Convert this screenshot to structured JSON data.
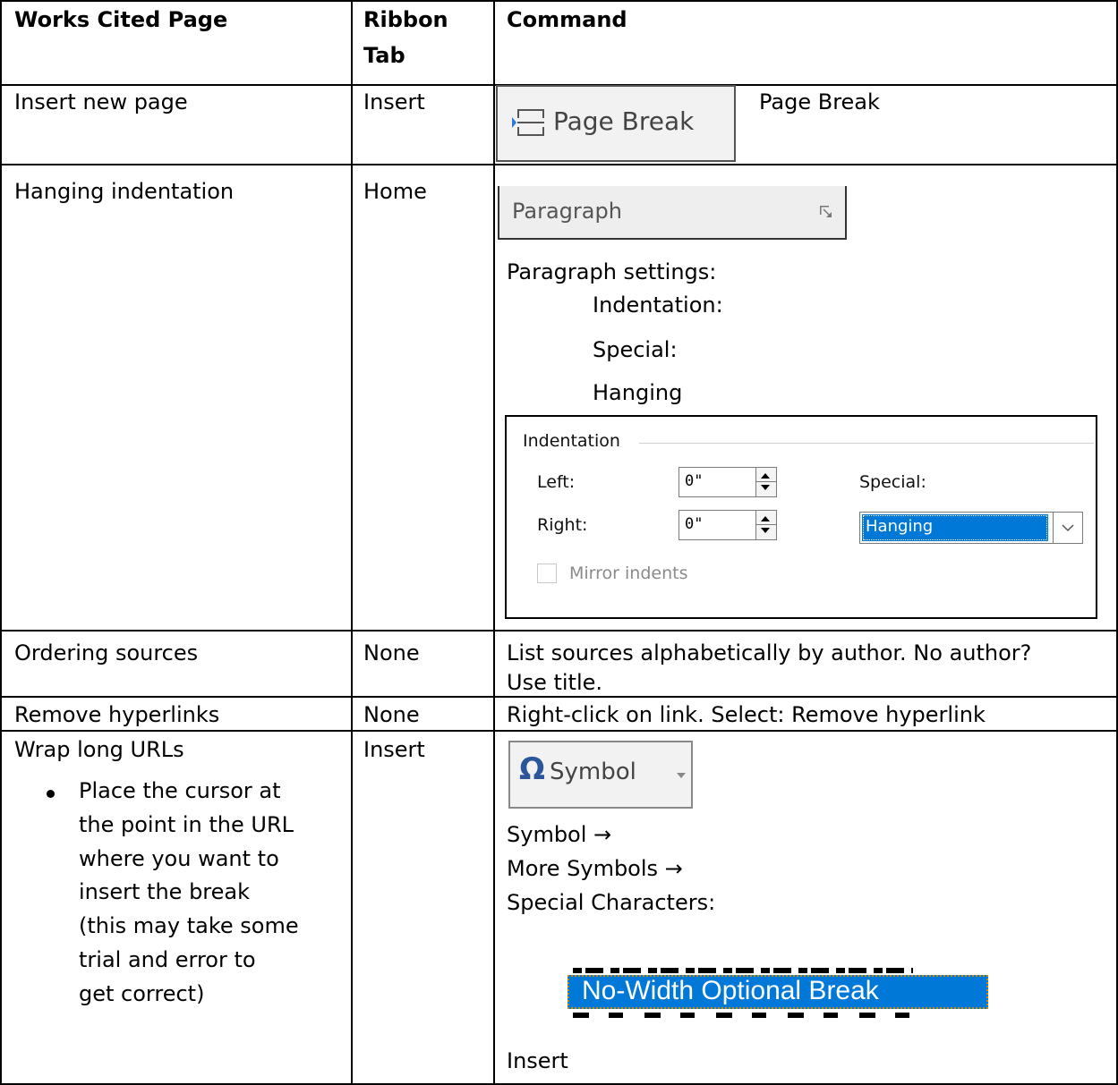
{
  "header": {
    "col1": "Works Cited Page",
    "col2_line1": "Ribbon",
    "col2_line2": "Tab",
    "col3": "Command"
  },
  "rows": {
    "insert_page": {
      "task": "Insert new page",
      "tab": "Insert",
      "button_label": "Page Break",
      "command": "Page Break"
    },
    "hanging": {
      "task": "Hanging indentation",
      "tab": "Home",
      "group_label": "Paragraph",
      "settings": "Paragraph settings:",
      "step1": "Indentation:",
      "step2": "Special:",
      "step3": "Hanging",
      "dialog": {
        "group_title": "Indentation",
        "left_label": "Left:",
        "left_value": "0\"",
        "right_label": "Right:",
        "right_value": "0\"",
        "special_label": "Special:",
        "special_value": "Hanging",
        "mirror_label": "Mirror indents"
      }
    },
    "ordering": {
      "task": "Ordering sources",
      "tab": "None",
      "line1": "List sources alphabetically by author. No author?",
      "line2": "Use title."
    },
    "hyperlinks": {
      "task": "Remove hyperlinks",
      "tab": "None",
      "command": "Right-click on link. Select: Remove hyperlink"
    },
    "wrap": {
      "task": "Wrap long URLs",
      "bullet_lines": [
        "Place the cursor at",
        "the point in the URL",
        "where you want to",
        "insert the break",
        "(this may take some",
        "trial and error to",
        "get correct)"
      ],
      "tab": "Insert",
      "symbol_label": "Symbol",
      "step1": "Symbol →",
      "step2": "More Symbols →",
      "step3": "Special Characters:",
      "list_item": "No-Width Optional Break",
      "step4": "Insert"
    }
  }
}
